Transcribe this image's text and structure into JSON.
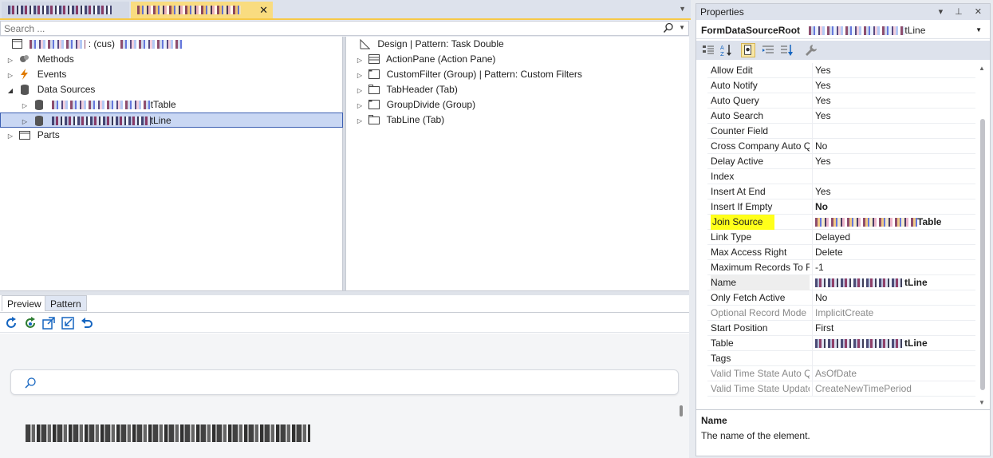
{
  "doc_tabs": {
    "close_glyph": "✕",
    "overflow_glyph": "▼"
  },
  "search": {
    "placeholder": "Search ..."
  },
  "tree": {
    "root_suffix": ": (cus)",
    "nodes": [
      {
        "label": "Methods",
        "icon": "methods-icon"
      },
      {
        "label": "Events",
        "icon": "events-icon"
      },
      {
        "label": "Data Sources",
        "icon": "database-icon"
      },
      {
        "label": "tTable",
        "icon": "database-icon"
      },
      {
        "label": "tLine",
        "icon": "database-icon"
      },
      {
        "label": "Parts",
        "icon": "parts-icon"
      }
    ]
  },
  "design": {
    "root": "Design | Pattern: Task Double",
    "nodes": [
      "ActionPane (Action Pane)",
      "CustomFilter (Group) | Pattern: Custom Filters",
      "TabHeader (Tab)",
      "GroupDivide (Group)",
      "TabLine (Tab)"
    ]
  },
  "preview": {
    "tabs": [
      "Preview",
      "Pattern"
    ]
  },
  "properties": {
    "title": "Properties",
    "title_buttons": "▾ ⊥ ✕",
    "object_type": "FormDataSourceRoot",
    "object_name_suffix": "tLine",
    "rows": [
      {
        "name": "Allow Edit",
        "value": "Yes"
      },
      {
        "name": "Auto Notify",
        "value": "Yes"
      },
      {
        "name": "Auto Query",
        "value": "Yes"
      },
      {
        "name": "Auto Search",
        "value": "Yes"
      },
      {
        "name": "Counter Field",
        "value": ""
      },
      {
        "name": "Cross Company Auto Query",
        "value": "No"
      },
      {
        "name": "Delay Active",
        "value": "Yes"
      },
      {
        "name": "Index",
        "value": ""
      },
      {
        "name": "Insert At End",
        "value": "Yes"
      },
      {
        "name": "Insert If Empty",
        "value": "No"
      },
      {
        "name": "Join Source",
        "value": "Table"
      },
      {
        "name": "Link Type",
        "value": "Delayed"
      },
      {
        "name": "Max Access Right",
        "value": "Delete"
      },
      {
        "name": "Maximum Records To Retrieve",
        "value": "-1"
      },
      {
        "name": "Name",
        "value": "tLine"
      },
      {
        "name": "Only Fetch Active",
        "value": "No"
      },
      {
        "name": "Optional Record Mode",
        "value": "ImplicitCreate"
      },
      {
        "name": "Start Position",
        "value": "First"
      },
      {
        "name": "Table",
        "value": "tLine"
      },
      {
        "name": "Tags",
        "value": ""
      },
      {
        "name": "Valid Time State Auto Query",
        "value": "AsOfDate"
      },
      {
        "name": "Valid Time State Update",
        "value": "CreateNewTimePeriod"
      }
    ],
    "description_title": "Name",
    "description_text": "The name of the element."
  },
  "colors": {
    "accent_tab": "#f9dc80",
    "highlight": "#ffff1a",
    "selection": "#c9d7f3"
  }
}
